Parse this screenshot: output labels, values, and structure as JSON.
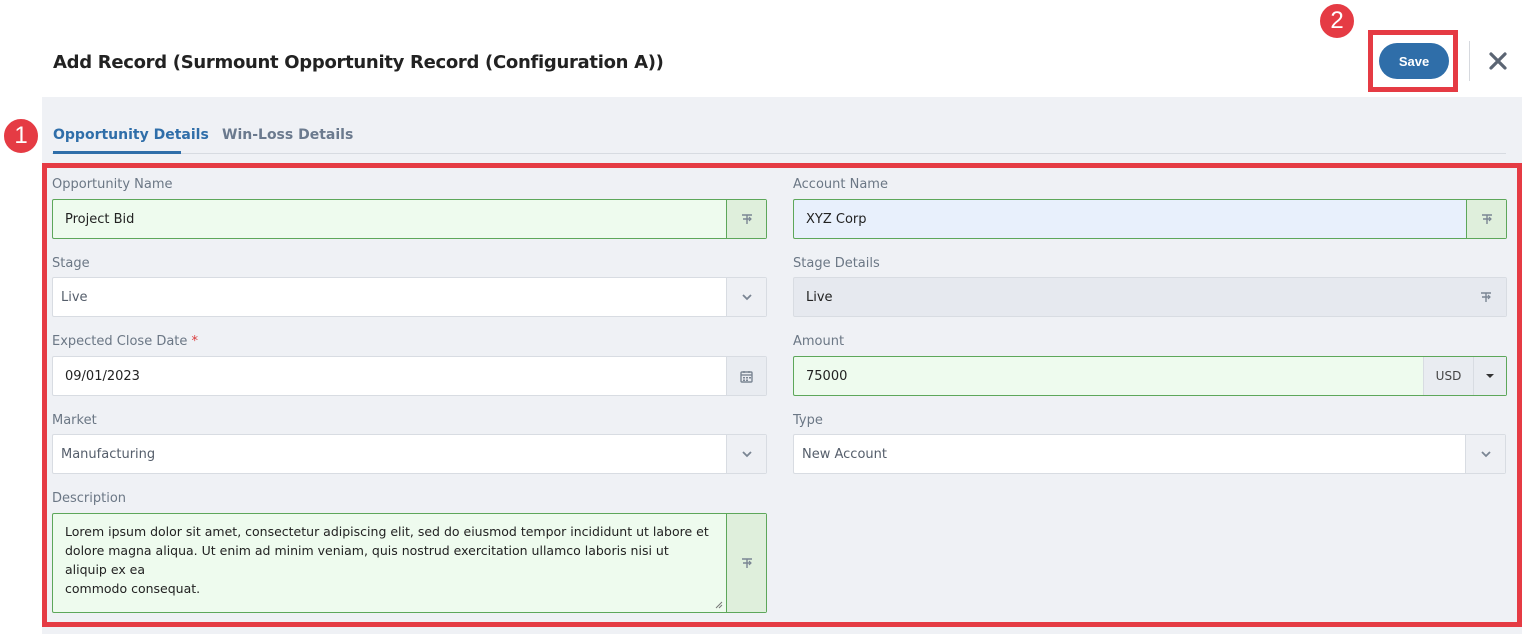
{
  "header": {
    "title": "Add Record (Surmount Opportunity Record (Configuration A))",
    "save_label": "Save"
  },
  "annotations": {
    "badge_1": "1",
    "badge_2": "2",
    "highlight_color": "#e53b44"
  },
  "tabs": [
    {
      "label": "Opportunity Details",
      "active": true
    },
    {
      "label": "Win-Loss Details",
      "active": false
    }
  ],
  "form": {
    "opportunity_name": {
      "label": "Opportunity Name",
      "value": "Project Bid",
      "icon": "text-format-icon"
    },
    "account_name": {
      "label": "Account Name",
      "value": "XYZ Corp",
      "icon": "text-format-icon"
    },
    "stage": {
      "label": "Stage",
      "value": "Live",
      "icon": "chevron-down-icon"
    },
    "stage_details": {
      "label": "Stage Details",
      "value": "Live",
      "icon": "text-format-icon"
    },
    "expected_close_date": {
      "label": "Expected Close Date",
      "required_mark": "*",
      "value": "09/01/2023",
      "icon": "calendar-icon"
    },
    "amount": {
      "label": "Amount",
      "value": "75000",
      "currency": "USD",
      "icon": "caret-down-icon"
    },
    "market": {
      "label": "Market",
      "value": "Manufacturing",
      "icon": "chevron-down-icon"
    },
    "type": {
      "label": "Type",
      "value": "New Account",
      "icon": "chevron-down-icon"
    },
    "description": {
      "label": "Description",
      "lines": [
        "Lorem ipsum dolor sit amet, consectetur adipiscing elit, sed do eiusmod tempor incididunt ut labore et",
        "dolore magna aliqua. Ut enim ad minim veniam, quis nostrud exercitation ullamco laboris nisi ut aliquip ex ea",
        "commodo consequat."
      ],
      "icon": "text-format-icon"
    }
  },
  "colors": {
    "accent": "#2f6ea9",
    "valid_border": "#5da75a",
    "valid_bg": "#eefbee",
    "account_bg": "#e8f0fc"
  }
}
